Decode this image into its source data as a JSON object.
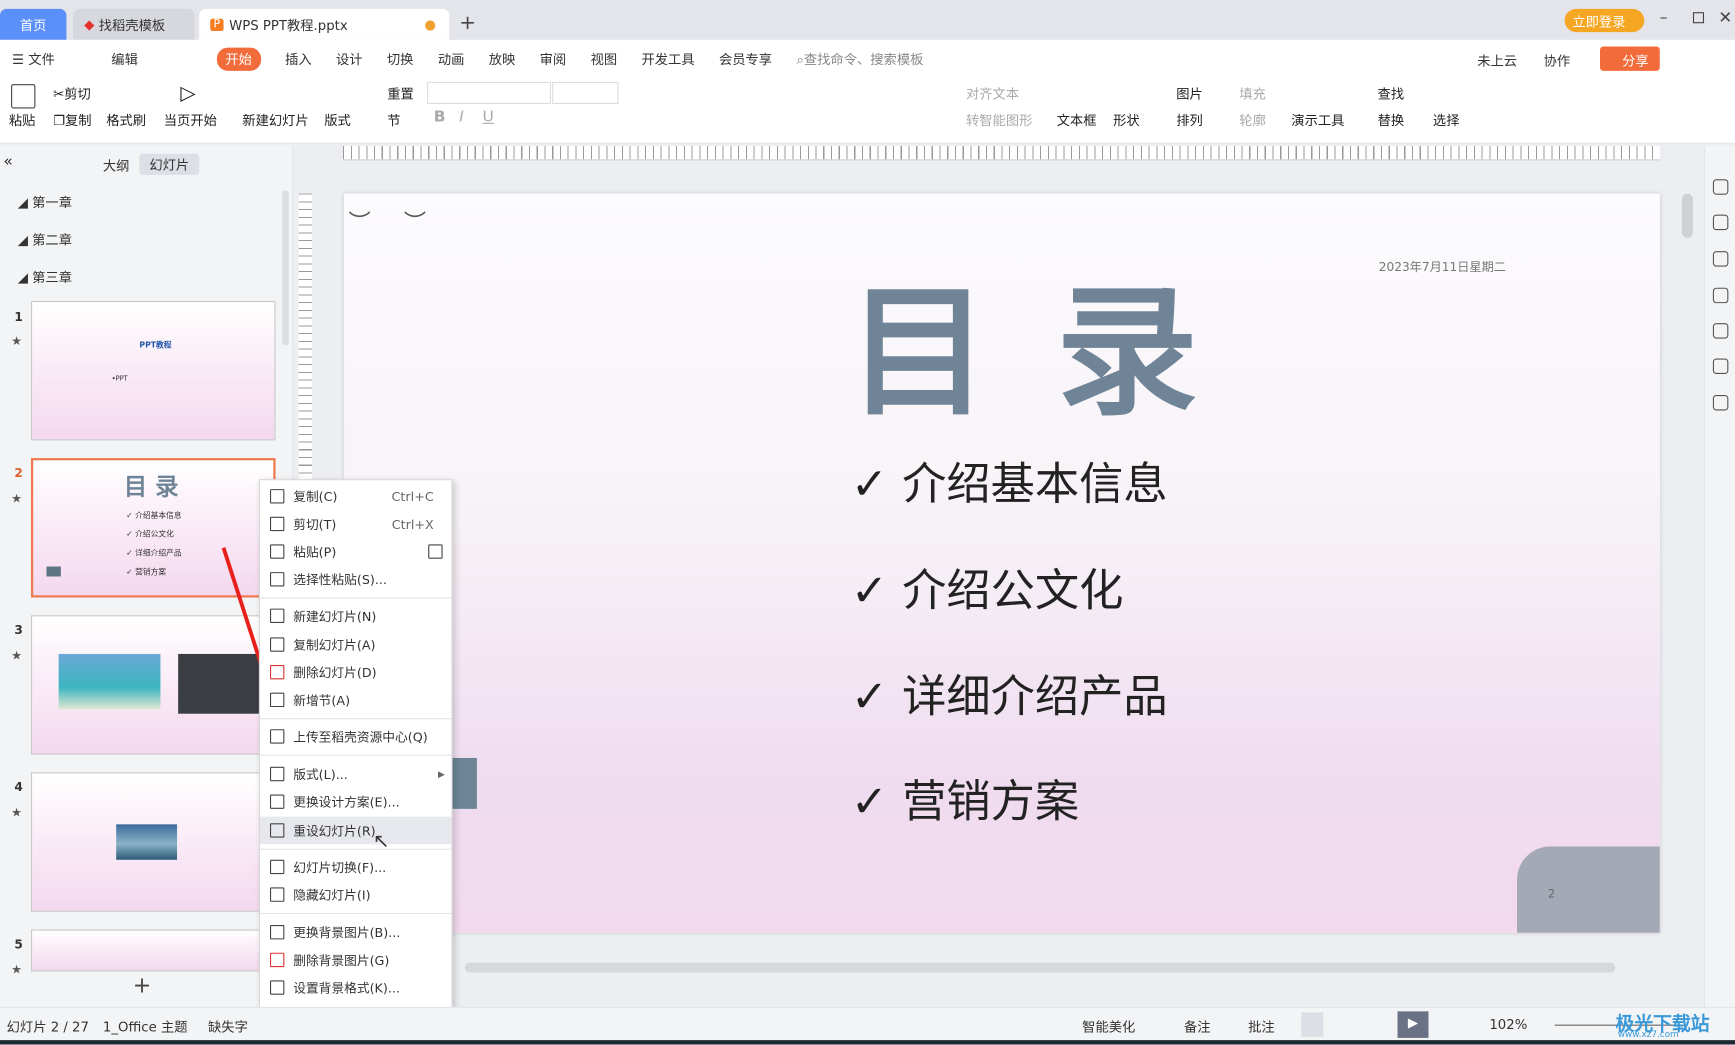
{
  "titlebar": {
    "tabs": [
      {
        "label": "首页"
      },
      {
        "label": "找稻壳模板"
      },
      {
        "label": "WPS PPT教程.pptx"
      }
    ],
    "new_tab": "+",
    "login": "立即登录",
    "colors": {
      "home_tab": "#5b8ff9",
      "login": "#f5a623",
      "accent": "#f26b3a"
    }
  },
  "menubar": {
    "file": "文件",
    "edit": "编辑",
    "tabs": [
      "开始",
      "插入",
      "设计",
      "切换",
      "动画",
      "放映",
      "审阅",
      "视图",
      "开发工具",
      "会员专享"
    ],
    "search": "查找命令、搜索模板",
    "cloud": "未上云",
    "collab": "协作",
    "share": "分享"
  },
  "ribbon": {
    "paste": "粘贴",
    "cut": "剪切",
    "copy": "复制",
    "format_painter": "格式刷",
    "from_current": "当页开始",
    "new_slide": "新建幻灯片",
    "layout": "版式",
    "reset": "重置",
    "section": "节",
    "bold": "B",
    "italic": "I",
    "underline": "U",
    "align_text": "对齐文本",
    "smart_art": "转智能图形",
    "textbox": "文本框",
    "shape": "形状",
    "picture": "图片",
    "arrange": "排列",
    "fill": "填充",
    "outline": "轮廓",
    "present_tools": "演示工具",
    "find": "查找",
    "replace": "替换",
    "select": "选择"
  },
  "left_panel": {
    "tabs": [
      "大纲",
      "幻灯片"
    ],
    "sections": [
      "第一章",
      "第二章",
      "第三章"
    ],
    "slides": [
      {
        "num": "1",
        "title": "PPT教程",
        "subtitle": "•PPT"
      },
      {
        "num": "2",
        "title": "目 录",
        "items": [
          "介绍基本信息",
          "介绍公文化",
          "详细介绍产品",
          "营销方案"
        ]
      },
      {
        "num": "3"
      },
      {
        "num": "4"
      },
      {
        "num": "5"
      }
    ],
    "add": "+"
  },
  "slide": {
    "title": "目 录",
    "date": "2023年7月11日星期二",
    "check": "✓",
    "items": [
      "介绍基本信息",
      "介绍公文化",
      "详细介绍产品",
      "营销方案"
    ],
    "page_num": "2",
    "title_color": "#6f8597"
  },
  "context_menu": {
    "items": [
      {
        "label": "复制(C)",
        "shortcut": "Ctrl+C"
      },
      {
        "label": "剪切(T)",
        "shortcut": "Ctrl+X"
      },
      {
        "label": "粘贴(P)"
      },
      {
        "label": "选择性粘贴(S)..."
      },
      {
        "label": "新建幻灯片(N)"
      },
      {
        "label": "复制幻灯片(A)"
      },
      {
        "label": "删除幻灯片(D)"
      },
      {
        "label": "新增节(A)"
      },
      {
        "label": "上传至稻壳资源中心(Q)"
      },
      {
        "label": "版式(L)..."
      },
      {
        "label": "更换设计方案(E)..."
      },
      {
        "label": "重设幻灯片(R)"
      },
      {
        "label": "幻灯片切换(F)..."
      },
      {
        "label": "隐藏幻灯片(I)"
      },
      {
        "label": "更换背景图片(B)..."
      },
      {
        "label": "删除背景图片(G)"
      },
      {
        "label": "设置背景格式(K)..."
      }
    ],
    "highlighted": "重设幻灯片(R)"
  },
  "status": {
    "slide": "幻灯片 2 / 27",
    "theme": "1_Office 主题",
    "missing_font": "缺失字",
    "beautify": "智能美化",
    "notes": "备注",
    "comments": "批注",
    "zoom": "102%"
  },
  "watermark": {
    "text": "极光下载站",
    "url": "www.xz7.com"
  }
}
